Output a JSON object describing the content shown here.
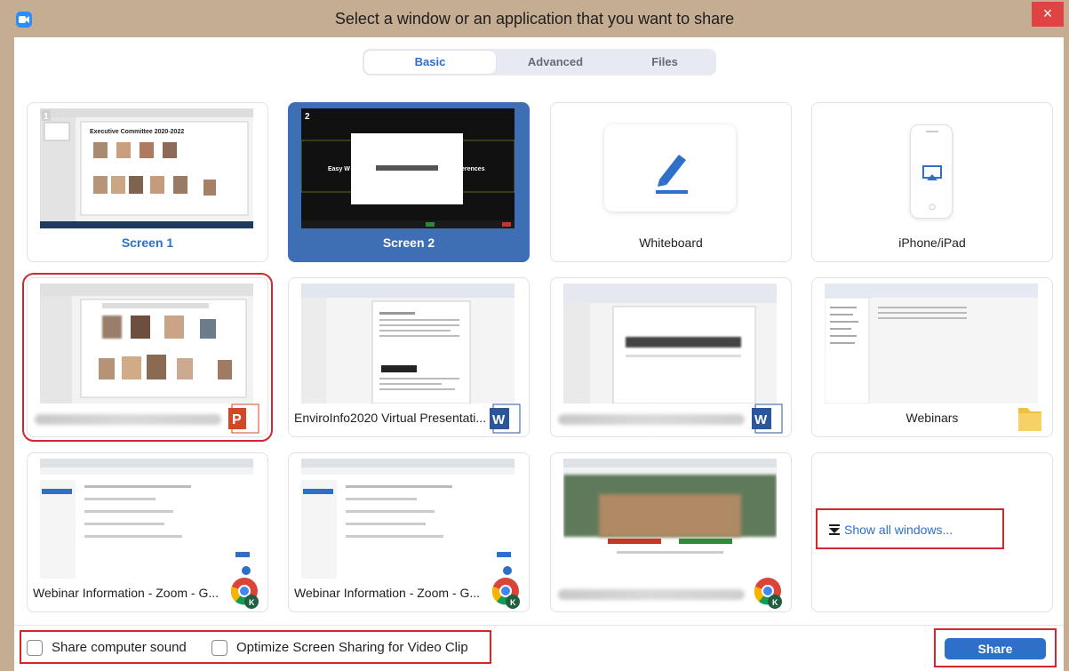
{
  "window": {
    "title": "Select a window or an application that you want to share",
    "close_glyph": "×"
  },
  "tabs": [
    {
      "label": "Basic",
      "active": true
    },
    {
      "label": "Advanced",
      "active": false
    },
    {
      "label": "Files",
      "active": false
    }
  ],
  "screens": [
    {
      "label": "Screen 1",
      "number": "1",
      "slide_title": "Executive Committee 2020-2022"
    },
    {
      "label": "Screen 2",
      "number": "2",
      "selected": true,
      "partial_text_left": "Easy W",
      "partial_text_right": "erences"
    }
  ],
  "special": [
    {
      "label": "Whiteboard",
      "icon": "pen-icon"
    },
    {
      "label": "iPhone/iPad",
      "icon": "airplay-icon"
    }
  ],
  "windows_row2": [
    {
      "label": "",
      "app": "powerpoint",
      "blurred": true,
      "highlighted": true
    },
    {
      "label": "EnviroInfo2020 Virtual Presentati...",
      "app": "word"
    },
    {
      "label": "",
      "app": "word",
      "blurred": true
    },
    {
      "label": "Webinars",
      "app": "folder"
    }
  ],
  "windows_row3": [
    {
      "label": "Webinar Information - Zoom - G...",
      "app": "chrome"
    },
    {
      "label": "Webinar Information - Zoom - G...",
      "app": "chrome"
    },
    {
      "label": "",
      "app": "chrome",
      "blurred": true
    }
  ],
  "show_all": {
    "label": "Show all windows..."
  },
  "footer": {
    "share_sound": "Share computer sound",
    "optimize": "Optimize Screen Sharing for Video Clip",
    "share_button": "Share"
  },
  "badge_letters": {
    "powerpoint": "P",
    "word": "W",
    "chrome": "K"
  },
  "colors": {
    "accent": "#2d6fc9",
    "highlight": "#d3262e",
    "selected_card": "#3e6fb5",
    "title_bar": "#c4ad92"
  }
}
